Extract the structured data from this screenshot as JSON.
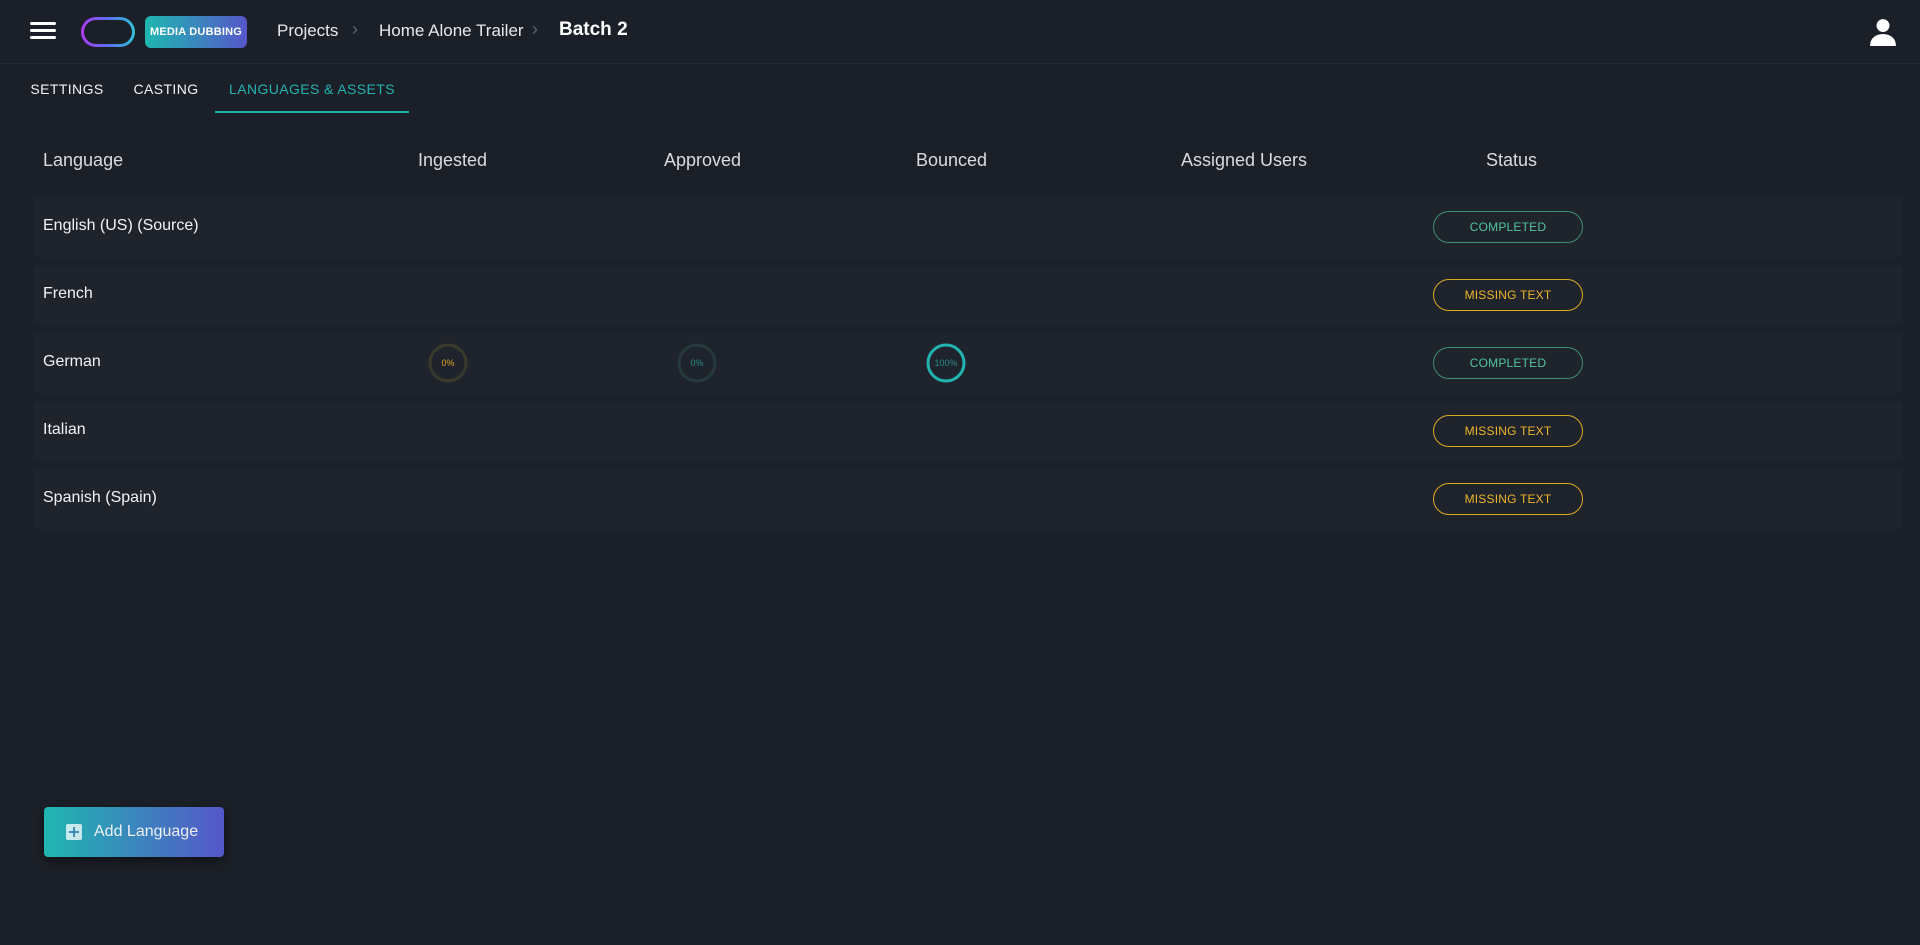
{
  "header": {
    "app_badge": "MEDIA DUBBING",
    "breadcrumbs": [
      "Projects",
      "Home Alone Trailer"
    ],
    "current": "Batch 2"
  },
  "tabs": [
    {
      "label": "SETTINGS",
      "active": false
    },
    {
      "label": "CASTING",
      "active": false
    },
    {
      "label": "LANGUAGES & ASSETS",
      "active": true
    }
  ],
  "table": {
    "columns": [
      "Language",
      "Ingested",
      "Approved",
      "Bounced",
      "Assigned Users",
      "Status"
    ],
    "rows": [
      {
        "language": "English (US) (Source)",
        "status": "COMPLETED",
        "status_kind": "completed"
      },
      {
        "language": "French",
        "status": "MISSING TEXT",
        "status_kind": "missing"
      },
      {
        "language": "German",
        "ingested": "0%",
        "approved": "0%",
        "bounced": "100%",
        "status": "COMPLETED",
        "status_kind": "completed"
      },
      {
        "language": "Italian",
        "status": "MISSING TEXT",
        "status_kind": "missing"
      },
      {
        "language": "Spanish (Spain)",
        "status": "MISSING TEXT",
        "status_kind": "missing"
      }
    ]
  },
  "progress": {
    "german": {
      "ingested": {
        "value": 0,
        "color": "#e0a823",
        "track": "#3a3a2c"
      },
      "approved": {
        "value": 0,
        "color": "#22b3b0",
        "track": "#263a3d"
      },
      "bounced": {
        "value": 100,
        "color": "#22b3b0",
        "track": "#263a3d"
      }
    }
  },
  "add_language_button": "Add Language",
  "colors": {
    "accent": "#22b3b0",
    "completed": "#4fc79b",
    "missing": "#f0b52a",
    "background": "#1b1f27"
  },
  "icons": [
    "menu-icon",
    "app-logo",
    "chevron-right-icon",
    "user-icon",
    "add-box-icon"
  ]
}
